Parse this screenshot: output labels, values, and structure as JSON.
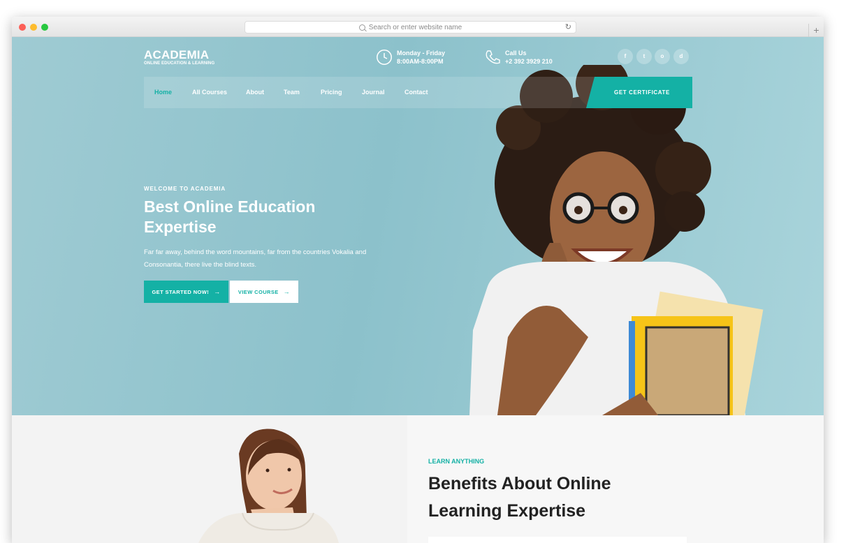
{
  "browser": {
    "url_placeholder": "Search or enter website name",
    "reload_glyph": "↻",
    "newtab_glyph": "+"
  },
  "brand": {
    "name": "ACADEMIA",
    "tagline": "ONLINE EDUCATION & LEARNING"
  },
  "header": {
    "hours_label": "Monday - Friday",
    "hours_value": "8:00AM-8:00PM",
    "call_label": "Call Us",
    "call_value": "+2 392 3929 210",
    "social": [
      "f",
      "t",
      "o",
      "d"
    ]
  },
  "nav": {
    "items": [
      "Home",
      "All Courses",
      "About",
      "Team",
      "Pricing",
      "Journal",
      "Contact"
    ],
    "active": "Home",
    "cta": "GET CERTIFICATE"
  },
  "hero": {
    "kicker": "WELCOME TO ACADEMIA",
    "title": "Best Online Education Expertise",
    "text": "Far far away, behind the word mountains, far from the countries Vokalia and Consonantia, there live the blind texts.",
    "primary_button": "GET STARTED NOW!",
    "secondary_button": "VIEW COURSE",
    "arrow": "→"
  },
  "benefits": {
    "kicker": "LEARN ANYTHING",
    "title": "Benefits About Online Learning Expertise"
  },
  "colors": {
    "accent": "#14b1a5",
    "hero_bg": "#9fcbd3",
    "white": "#ffffff"
  }
}
